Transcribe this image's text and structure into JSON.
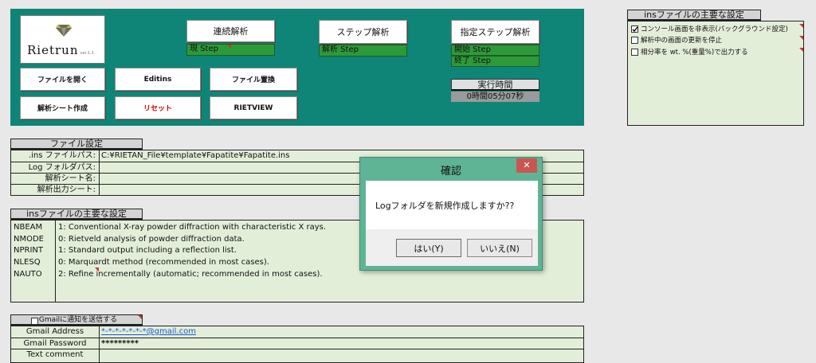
{
  "logo": {
    "text": "Rietrun",
    "version": "ver.1.3"
  },
  "buttons": {
    "continuous": "連続解析",
    "step": "ステップ解析",
    "specified_step": "指定ステップ解析",
    "open_file": "ファイルを開く",
    "editins": "Editins",
    "replace_file": "ファイル置換",
    "create_sheet": "解析シート作成",
    "reset": "リセット",
    "rietview": "RIETVIEW"
  },
  "status": {
    "current_step": "現 Step",
    "analysis_step": "解析 Step",
    "start_step": "開始 Step",
    "end_step": "終了 Step",
    "exec_time_label": "実行時間",
    "exec_time_value": "0時間05分07秒"
  },
  "settings_panel": {
    "title": "insファイルの主要な設定",
    "options": [
      {
        "label": "コンソール画面を非表示(バックグラウンド設定)",
        "checked": true
      },
      {
        "label": "解析中の画面の更新を停止",
        "checked": false
      },
      {
        "label": "相分率を wt. %(重量%)で出力する",
        "checked": false
      }
    ]
  },
  "file_settings": {
    "title": "ファイル設定",
    "rows": [
      {
        "label": ".ins ファイルパス:",
        "value": "C:¥RIETAN_File¥template¥Fapatite¥Fapatite.ins"
      },
      {
        "label": "Log フォルダパス:",
        "value": ""
      },
      {
        "label": "解析シート名:",
        "value": ""
      },
      {
        "label": "解析出力シート:",
        "value": ""
      }
    ]
  },
  "ins_settings": {
    "title": "insファイルの主要な設定",
    "rows": [
      {
        "key": "NBEAM",
        "value": "1: Conventional X-ray powder diffraction with characteristic X rays."
      },
      {
        "key": "NMODE",
        "value": "0: Rietveld analysis of powder diffraction data."
      },
      {
        "key": "NPRINT",
        "value": "1: Standard output including a reflection list."
      },
      {
        "key": "NLESQ",
        "value": "0: Marquardt method (recommended in most cases)."
      },
      {
        "key": "NAUTO",
        "value": "2: Refine incrementally (automatic; recommended in most cases)."
      }
    ]
  },
  "gmail": {
    "checkbox_label": "Gmailに通知を送信する",
    "rows": [
      {
        "label": "Gmail Address",
        "value": "*-*-*-*-*-*-*@gmail.com"
      },
      {
        "label": "Gmail Password",
        "value": "*********"
      },
      {
        "label": "Text comment",
        "value": ""
      }
    ]
  },
  "dialog": {
    "title": "確認",
    "message": "Logフォルダを新規作成しますか??",
    "yes": "はい(Y)",
    "no": "いいえ(N)",
    "close": "✕"
  }
}
